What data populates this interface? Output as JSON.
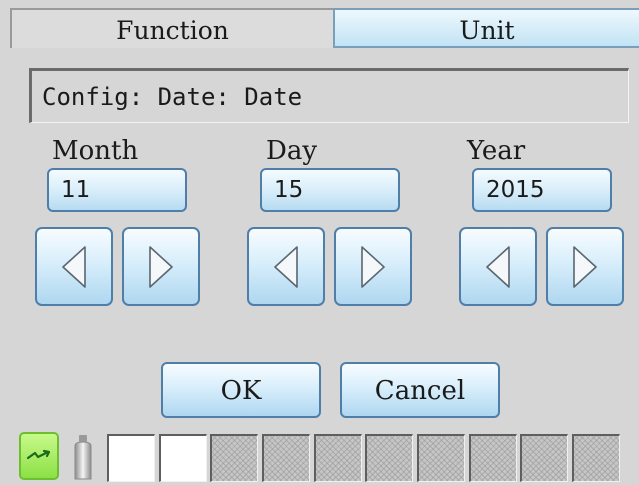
{
  "tabs": [
    {
      "label": "Function",
      "selected": true
    },
    {
      "label": "Unit",
      "selected": false
    }
  ],
  "breadcrumb": "Config: Date: Date",
  "fields": [
    {
      "label": "Month",
      "value": "11"
    },
    {
      "label": "Day",
      "value": "15"
    },
    {
      "label": "Year",
      "value": "2015"
    }
  ],
  "buttons": {
    "ok": "OK",
    "cancel": "Cancel"
  },
  "icons": {
    "decrement": "left-triangle-icon",
    "increment": "right-triangle-icon",
    "storage": "sd-card-icon",
    "container": "bottle-icon"
  },
  "status_slots": [
    "empty",
    "empty",
    "hatched",
    "hatched",
    "hatched",
    "hatched",
    "hatched",
    "hatched",
    "hatched",
    "hatched"
  ],
  "colors": {
    "background": "#d6d6d6",
    "button_border": "#4f7ea8",
    "button_fill": "#d8eefb",
    "sd_icon": "#8be046"
  }
}
